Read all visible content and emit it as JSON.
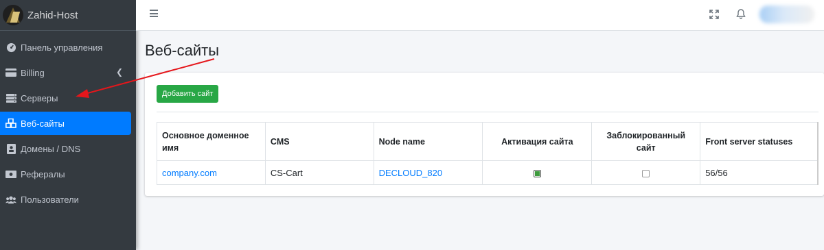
{
  "brand": {
    "name": "Zahid-Host"
  },
  "sidebar": {
    "items": [
      {
        "label": "Панель управления",
        "icon": "tachometer-icon"
      },
      {
        "label": "Billing",
        "icon": "credit-card-icon"
      },
      {
        "label": "Серверы",
        "icon": "server-icon"
      },
      {
        "label": "Веб-сайты",
        "icon": "cubes-icon",
        "active": true
      },
      {
        "label": "Домены / DNS",
        "icon": "id-card-icon"
      },
      {
        "label": "Рефералы",
        "icon": "money-bill-icon"
      },
      {
        "label": "Пользователи",
        "icon": "users-icon"
      }
    ]
  },
  "page": {
    "title": "Веб-сайты"
  },
  "toolbar": {
    "add_label": "Добавить сайт"
  },
  "table": {
    "headers": [
      "Основное доменное имя",
      "CMS",
      "Node name",
      "Активация сайта",
      "Заблокированный сайт",
      "Front server statuses"
    ],
    "rows": [
      {
        "domain": "company.com",
        "cms": "CS-Cart",
        "node": "DECLOUD_820",
        "activation": true,
        "blocked": false,
        "front_status": "56/56"
      }
    ]
  },
  "colors": {
    "sidebar_bg": "#343a40",
    "active": "#007bff",
    "add_button": "#28a745",
    "link": "#007bff",
    "arrow": "#e5161b"
  }
}
